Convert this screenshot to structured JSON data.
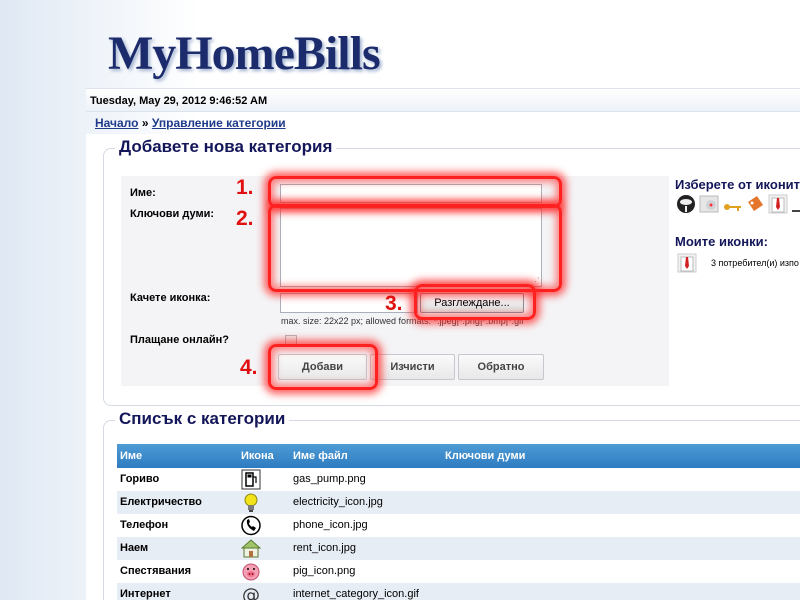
{
  "header": {
    "logo": "MyHomeBills",
    "datetime": "Tuesday, May 29, 2012 9:46:52 AM"
  },
  "breadcrumb": {
    "home": "Начало",
    "separator": "»",
    "current": "Управление категории"
  },
  "add_form": {
    "title": "Добавете нова категория",
    "name_label": "Име:",
    "name_value": "",
    "keywords_label": "Ключови думи:",
    "keywords_value": "",
    "upload_label": "Качете иконка:",
    "browse_button": "Разглеждане...",
    "upload_hint": "max. size: 22x22 px; allowed formats: *.jpeg|*.png|*.bmp|*.gif",
    "online_pay_label": "Плащане онлайн?",
    "online_pay_checked": false,
    "add_button": "Добави",
    "clear_button": "Изчисти",
    "back_button": "Обратно"
  },
  "annotations": {
    "one": "1.",
    "two": "2.",
    "three": "3.",
    "four": "4.",
    "highlight_color": "#ff2020"
  },
  "side": {
    "choose_icons_title": "Изберете от иконит",
    "choose_icons": [
      "barbecue-icon",
      "disc-icon",
      "key-icon",
      "tag-icon",
      "shirt-icon"
    ],
    "my_icons_title": "Моите иконки:",
    "my_icon": "shirt-icon",
    "my_icon_text": "3  потребител(и) изпо"
  },
  "list": {
    "title": "Списък с категории",
    "columns": [
      "Име",
      "Икона",
      "Име файл",
      "Ключови думи"
    ],
    "rows": [
      {
        "name": "Гориво",
        "icon": "gas-pump-icon",
        "file": "gas_pump.png",
        "keywords": ""
      },
      {
        "name": "Електричество",
        "icon": "lightbulb-icon",
        "file": "electricity_icon.jpg",
        "keywords": ""
      },
      {
        "name": "Телефон",
        "icon": "phone-icon",
        "file": "phone_icon.jpg",
        "keywords": ""
      },
      {
        "name": "Наем",
        "icon": "house-icon",
        "file": "rent_icon.jpg",
        "keywords": ""
      },
      {
        "name": "Спестявания",
        "icon": "piggy-bank-icon",
        "file": "pig_icon.png",
        "keywords": ""
      },
      {
        "name": "Интернет",
        "icon": "at-sign-icon",
        "file": "internet_category_icon.gif",
        "keywords": ""
      }
    ]
  },
  "colors": {
    "accent": "#14165a",
    "link": "#1e3a8a",
    "table_header": "#3a87c9"
  }
}
